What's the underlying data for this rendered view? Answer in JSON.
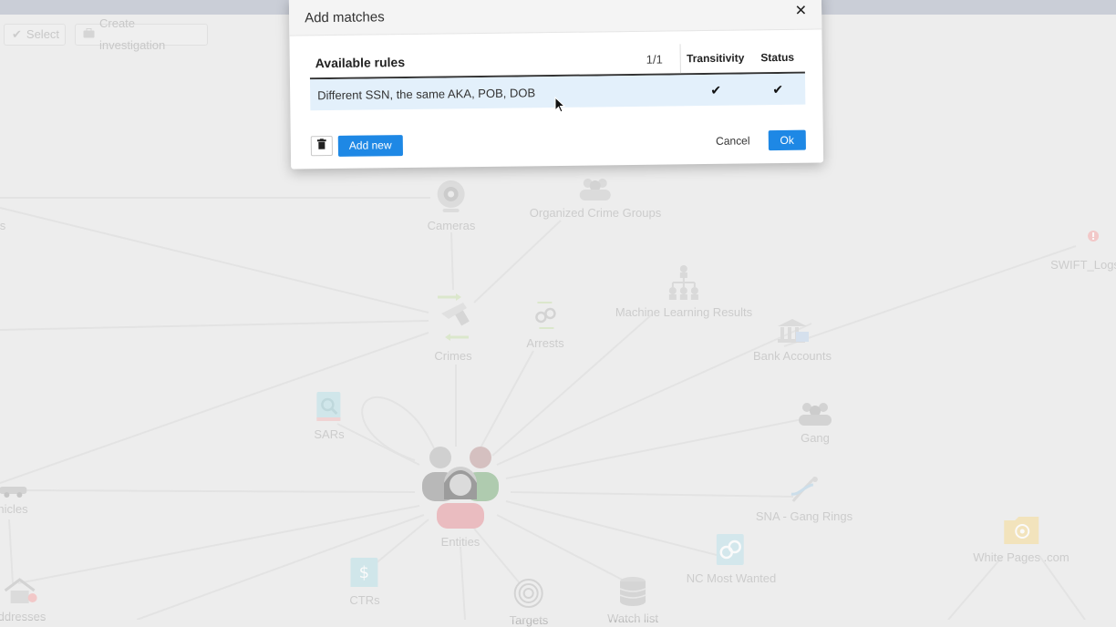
{
  "toolbar": {
    "select_label": "Select",
    "create_investigation_label": "Create investigation"
  },
  "graph": {
    "nodes": {
      "cameras": "Cameras",
      "organized_crime_groups": "Organized Crime Groups",
      "crimes": "Crimes",
      "arrests": "Arrests",
      "machine_learning_results": "Machine Learning Results",
      "bank_accounts": "Bank Accounts",
      "swift_logs": "SWIFT_Logs",
      "sars": "SARs",
      "gang": "Gang",
      "sna_gang_rings": "SNA - Gang Rings",
      "entities": "Entities",
      "nc_most_wanted": "NC Most Wanted",
      "white_pages": "White Pages .com",
      "ctrs": "CTRs",
      "targets": "Targets",
      "watch_list": "Watch list",
      "vehicles_partial": "hicles",
      "addresses_partial": "ddresses",
      "left_partial": "s"
    }
  },
  "modal": {
    "title": "Add matches",
    "table": {
      "header_name": "Available rules",
      "count": "1/1",
      "header_transitivity": "Transitivity",
      "header_status": "Status",
      "rows": [
        {
          "name": "Different SSN, the same AKA, POB, DOB",
          "transitivity": "✔",
          "status": "✔"
        }
      ]
    },
    "footer": {
      "add_new_label": "Add new",
      "cancel_label": "Cancel",
      "ok_label": "Ok"
    }
  },
  "colors": {
    "primary": "#1e88e5",
    "row_highlight": "#e3f0fb",
    "background": "#ececec"
  }
}
